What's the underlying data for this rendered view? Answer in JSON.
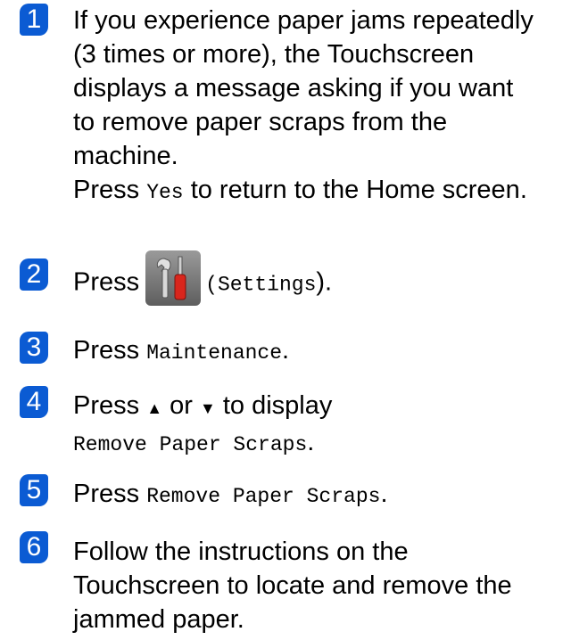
{
  "steps": [
    {
      "number": "1",
      "lines": [
        "If you experience paper jams repeatedly",
        "(3 times or more), the Touchscreen",
        "displays a message asking if you want",
        "to remove paper scraps from the",
        "machine."
      ],
      "press_word": "Press",
      "yes_label": "Yes",
      "after_yes": "to return to the Home screen."
    },
    {
      "number": "2",
      "press_word": "Press",
      "icon": "settings-tools-icon",
      "open_paren": "(",
      "settings_label": "Settings",
      "close_paren": ")."
    },
    {
      "number": "3",
      "press_word": "Press",
      "maintenance_label": "Maintenance",
      "period": "."
    },
    {
      "number": "4",
      "press_word": "Press",
      "up_symbol": "▲",
      "or_word": "or",
      "down_symbol": "▼",
      "to_display": "to display",
      "remove_label": "Remove Paper Scraps",
      "period": "."
    },
    {
      "number": "5",
      "press_word": "Press",
      "remove_label": "Remove Paper Scraps",
      "period": "."
    },
    {
      "number": "6",
      "lines": [
        "Follow the instructions on the",
        "Touchscreen to locate and remove the",
        "jammed paper."
      ]
    }
  ]
}
